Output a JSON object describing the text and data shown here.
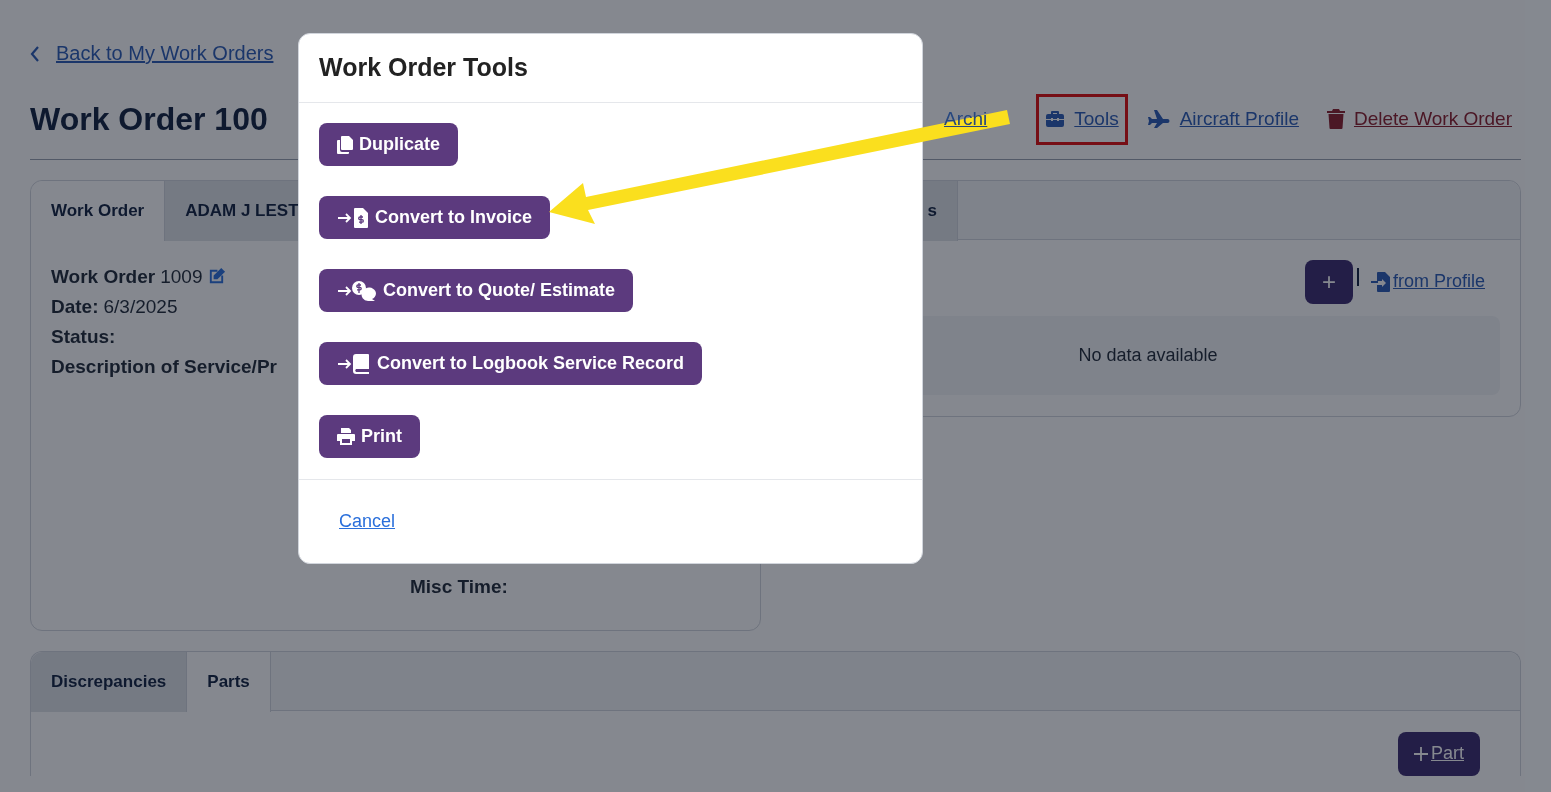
{
  "back_link": "Back to My Work Orders",
  "title": "Work Order 100",
  "header_actions": [
    {
      "kind": "archive",
      "label": "Archi",
      "danger": false,
      "highlighted": false
    },
    {
      "kind": "tools",
      "label": "Tools",
      "danger": false,
      "highlighted": true
    },
    {
      "kind": "aircraft",
      "label": "Aircraft Profile",
      "danger": false,
      "highlighted": false
    },
    {
      "kind": "delete",
      "label": "Delete Work Order",
      "danger": true,
      "highlighted": false
    }
  ],
  "details_card": {
    "tabs": [
      {
        "label": "Work Order",
        "selected": true
      },
      {
        "label": "ADAM J LEST",
        "selected": false
      }
    ],
    "fields": [
      {
        "label": "Work Order",
        "value": "1009",
        "editable": true
      },
      {
        "label": "Date:",
        "value": "6/3/2025",
        "editable": false
      },
      {
        "label": "Status:",
        "editable": false
      },
      {
        "label": "Description of Service/Pr",
        "editable": false
      }
    ],
    "misc_time_label": "Misc Time:"
  },
  "side_card": {
    "tabs": [
      {
        "label": "s",
        "selected": false
      }
    ],
    "add_button": "+",
    "from_profile_link": "from Profile",
    "empty_message": "No data available"
  },
  "bottom_card": {
    "tabs": [
      {
        "label": "Discrepancies",
        "selected": false
      },
      {
        "label": "Parts",
        "selected": true
      }
    ],
    "add_button": "Part"
  },
  "modal": {
    "title": "Work Order Tools",
    "actions": [
      {
        "kind": "duplicate",
        "label": "Duplicate"
      },
      {
        "kind": "invoice",
        "label": "Convert to Invoice"
      },
      {
        "kind": "quote",
        "label": "Convert to Quote/ Estimate"
      },
      {
        "kind": "logbook",
        "label": "Convert to Logbook Service Record"
      },
      {
        "kind": "print",
        "label": "Print"
      }
    ],
    "cancel": "Cancel"
  }
}
